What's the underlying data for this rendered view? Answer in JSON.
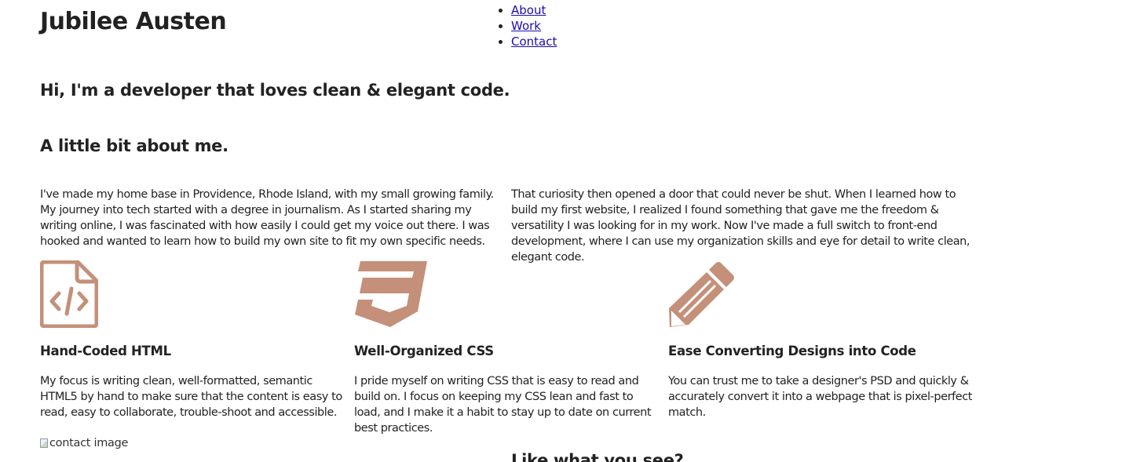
{
  "header": {
    "site_title": "Jubilee Austen",
    "nav": [
      {
        "label": "About"
      },
      {
        "label": "Work"
      },
      {
        "label": "Contact"
      }
    ]
  },
  "hero": {
    "heading": "Hi, I'm a developer that loves clean & elegant code."
  },
  "about": {
    "heading": "A little bit about me.",
    "paragraph_left": "I've made my home base in Providence, Rhode Island, with my small growing family. My journey into tech started with a degree in journalism. As I started sharing my writing online, I was fascinated with how easily I could get my voice out there. I was hooked and wanted to learn how to build my own site to fit my own specific needs.",
    "paragraph_right": "That curiosity then opened a door that could never be shut. When I learned how to build my first website, I realized I found something that gave me the freedom & versatility I was looking for in my work. Now I've made a full switch to front-end development, where I can use my organization skills and eye for detail to write clean, elegant code."
  },
  "skills": [
    {
      "icon": "html-file-code-icon",
      "title": "Hand-Coded HTML",
      "description": "My focus is writing clean, well-formatted, semantic HTML5 by hand to make sure that the content is easy to read, easy to collaborate, trouble-shoot and accessible."
    },
    {
      "icon": "css3-icon",
      "title": "Well-Organized CSS",
      "description": "I pride myself on writing CSS that is easy to read and build on. I focus on keeping my CSS lean and fast to load, and I make it a habit to stay up to date on current best practices."
    },
    {
      "icon": "pencil-icon",
      "title": "Ease Converting Designs into Code",
      "description": "You can trust me to take a designer's PSD and quickly & accurately convert it into a webpage that is pixel-perfect match."
    }
  ],
  "contact": {
    "image_alt": "contact image",
    "heading": "Like what you see?"
  },
  "colors": {
    "icon_accent": "#c49079",
    "text": "#222222",
    "link": "#1a0dab"
  }
}
